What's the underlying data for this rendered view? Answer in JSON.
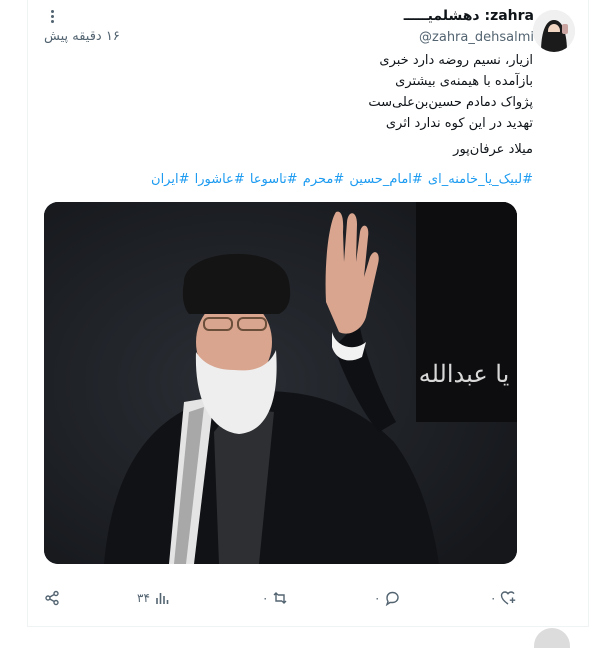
{
  "tweet": {
    "display_name": "zahra: دهشلمیـــــ",
    "username": "@zahra_dehsalmi",
    "time": "۱۶ دقیقه پیش",
    "lines": [
      "ازیار،  نسیم روضه دارد خبری",
      "بازآمده با هیمنه‌ی بیشتری",
      "پژواک دمادم حسین‌بن‌علی‌ست",
      "تهدید در این کوه ندارد اثری"
    ],
    "signature": "میلاد عرفان‌پور",
    "hashtags": "#لبیک_یا_خامنه_ای #امام_حسین #محرم #تاسوعا #عاشورا #ایران",
    "banner_text": "یا عبدالله",
    "views": "۳۴",
    "retweets": "۰",
    "replies": "۰",
    "likes": "۰"
  },
  "icons": {
    "more": "more-dots-icon",
    "share": "share-icon",
    "views": "views-bar-icon",
    "retweet": "retweet-icon",
    "reply": "reply-icon",
    "like": "heart-plus-icon"
  },
  "colors": {
    "link": "#1d9bf0",
    "muted": "#536471",
    "text": "#0f1419"
  }
}
